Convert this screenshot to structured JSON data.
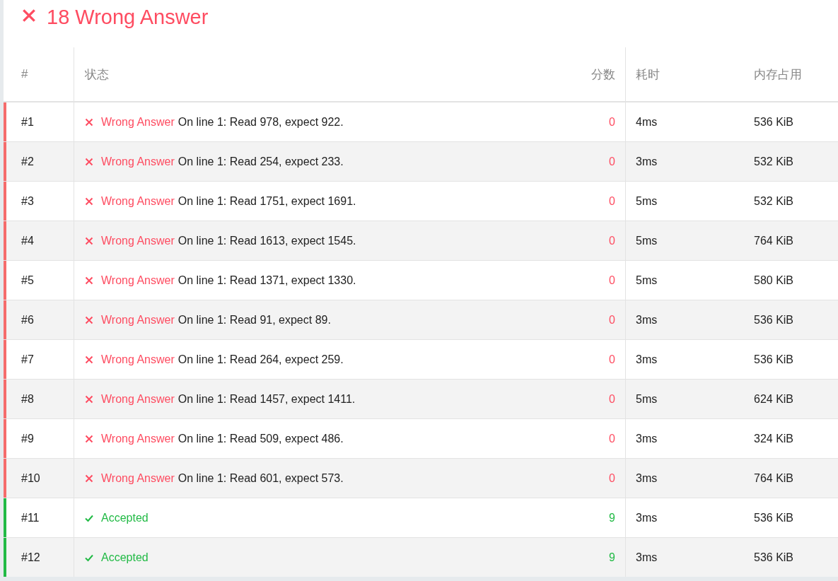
{
  "result": {
    "kind": "wrong",
    "title": "18 Wrong Answer"
  },
  "table": {
    "columns": [
      "#",
      "状态",
      "分数",
      "耗时",
      "内存占用"
    ],
    "rows": [
      {
        "id": "#1",
        "kind": "wrong",
        "status": "Wrong Answer",
        "detail": "On line 1: Read 978, expect 922.",
        "score": "0",
        "time": "4ms",
        "memory": "536 KiB"
      },
      {
        "id": "#2",
        "kind": "wrong",
        "status": "Wrong Answer",
        "detail": "On line 1: Read 254, expect 233.",
        "score": "0",
        "time": "3ms",
        "memory": "532 KiB"
      },
      {
        "id": "#3",
        "kind": "wrong",
        "status": "Wrong Answer",
        "detail": "On line 1: Read 1751, expect 1691.",
        "score": "0",
        "time": "5ms",
        "memory": "532 KiB"
      },
      {
        "id": "#4",
        "kind": "wrong",
        "status": "Wrong Answer",
        "detail": "On line 1: Read 1613, expect 1545.",
        "score": "0",
        "time": "5ms",
        "memory": "764 KiB"
      },
      {
        "id": "#5",
        "kind": "wrong",
        "status": "Wrong Answer",
        "detail": "On line 1: Read 1371, expect 1330.",
        "score": "0",
        "time": "5ms",
        "memory": "580 KiB"
      },
      {
        "id": "#6",
        "kind": "wrong",
        "status": "Wrong Answer",
        "detail": "On line 1: Read 91, expect 89.",
        "score": "0",
        "time": "3ms",
        "memory": "536 KiB"
      },
      {
        "id": "#7",
        "kind": "wrong",
        "status": "Wrong Answer",
        "detail": "On line 1: Read 264, expect 259.",
        "score": "0",
        "time": "3ms",
        "memory": "536 KiB"
      },
      {
        "id": "#8",
        "kind": "wrong",
        "status": "Wrong Answer",
        "detail": "On line 1: Read 1457, expect 1411.",
        "score": "0",
        "time": "5ms",
        "memory": "624 KiB"
      },
      {
        "id": "#9",
        "kind": "wrong",
        "status": "Wrong Answer",
        "detail": "On line 1: Read 509, expect 486.",
        "score": "0",
        "time": "3ms",
        "memory": "324 KiB"
      },
      {
        "id": "#10",
        "kind": "wrong",
        "status": "Wrong Answer",
        "detail": "On line 1: Read 601, expect 573.",
        "score": "0",
        "time": "3ms",
        "memory": "764 KiB"
      },
      {
        "id": "#11",
        "kind": "accepted",
        "status": "Accepted",
        "score": "9",
        "time": "3ms",
        "memory": "536 KiB"
      },
      {
        "id": "#12",
        "kind": "accepted",
        "status": "Accepted",
        "score": "9",
        "time": "3ms",
        "memory": "536 KiB"
      }
    ]
  }
}
